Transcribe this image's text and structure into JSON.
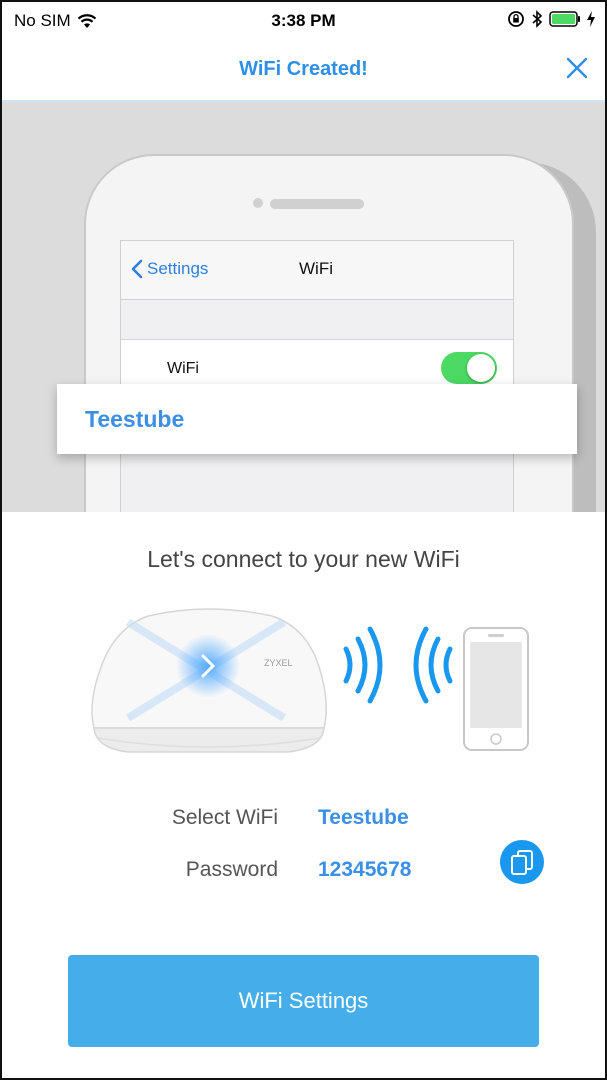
{
  "status_bar": {
    "carrier": "No SIM",
    "time": "3:38 PM"
  },
  "nav": {
    "title": "WiFi Created!"
  },
  "illustration": {
    "back_label": "Settings",
    "screen_title": "WiFi",
    "wifi_row_label": "WiFi",
    "wifi_toggle_on": true,
    "network_name": "Teestube",
    "router_brand": "ZYXEL"
  },
  "content": {
    "headline": "Let's connect to your new WiFi",
    "select_wifi_label": "Select WiFi",
    "select_wifi_value": "Teestube",
    "password_label": "Password",
    "password_value": "12345678"
  },
  "actions": {
    "wifi_settings_label": "WiFi Settings"
  },
  "colors": {
    "accent": "#2f8ee6",
    "button": "#45ade9",
    "toggle_on": "#4cd964"
  },
  "icons": [
    "wifi-signal-icon",
    "rotation-lock-icon",
    "bluetooth-icon",
    "battery-icon",
    "charging-icon",
    "close-icon",
    "chevron-left-icon",
    "copy-icon",
    "router-icon",
    "signal-waves-icon",
    "phone-icon"
  ]
}
